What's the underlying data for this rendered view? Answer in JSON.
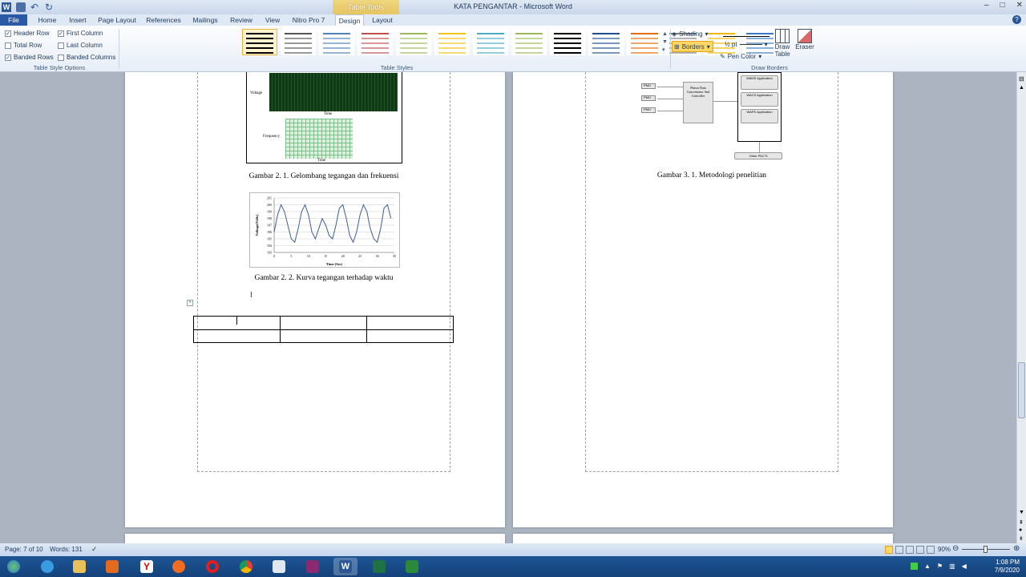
{
  "window": {
    "title": "KATA PENGANTAR - Microsoft Word",
    "context_tab": "Table Tools",
    "controls": [
      "–",
      "□",
      "✕"
    ]
  },
  "tabs": [
    "File",
    "Home",
    "Insert",
    "Page Layout",
    "References",
    "Mailings",
    "Review",
    "View",
    "Nitro Pro 7",
    "Design",
    "Layout"
  ],
  "active_tab": "Design",
  "ribbon": {
    "style_options": {
      "label": "Table Style Options",
      "items": [
        {
          "label": "Header Row",
          "checked": true
        },
        {
          "label": "First Column",
          "checked": true
        },
        {
          "label": "Total Row",
          "checked": false
        },
        {
          "label": "Last Column",
          "checked": false
        },
        {
          "label": "Banded Rows",
          "checked": true
        },
        {
          "label": "Banded Columns",
          "checked": false
        }
      ]
    },
    "table_styles": {
      "label": "Table Styles",
      "colors": [
        "#000000",
        "#555555",
        "#4f81bd",
        "#c0504d",
        "#9bbb59",
        "#f2c314",
        "#4bacc6",
        "#9bbb59",
        "#000000",
        "#1f4e99",
        "#e36c09",
        "#7f7f7f",
        "#f2b800",
        "#3b79c9"
      ]
    },
    "shading_label": "Shading",
    "borders_label": "Borders",
    "pen_weight": "½ pt",
    "pen_color_label": "Pen Color",
    "draw_borders": {
      "label": "Draw Borders",
      "draw_table": "Draw Table",
      "eraser": "Eraser"
    }
  },
  "document": {
    "left_page": {
      "figure1": {
        "caption": "Gambar 2. 1. Gelombang tegangan dan frekuensi",
        "label_voltage": "Voltage",
        "label_frequency": "Frequency",
        "label_time": "Time"
      },
      "figure2": {
        "caption": "Gambar 2. 2. Kurva tegangan terhadap waktu",
        "ylabel": "Voltage(Volts)",
        "xlabel": "Time (Sec)"
      }
    },
    "right_page": {
      "figure3": {
        "caption": "Gambar 3. 1. Metodologi penelitian",
        "pmu": "PMU",
        "pdc": "Phasor Data Concentrator And Controller",
        "apps": [
          "WAMS Application",
          "WACS Application",
          "WAPS Application"
        ],
        "other": "Other PDC'S"
      }
    }
  },
  "chart_data": {
    "type": "line",
    "title": "",
    "xlabel": "Time (Sec)",
    "ylabel": "Voltage(Volts)",
    "xlim": [
      0,
      35
    ],
    "ylim": [
      193,
      201
    ],
    "x_ticks": [
      0,
      5,
      10,
      15,
      20,
      25,
      30,
      35
    ],
    "y_ticks": [
      193,
      194,
      195,
      196,
      197,
      198,
      199,
      200,
      201
    ],
    "series": [
      {
        "x": [
          0,
          1,
          2,
          3,
          4,
          5,
          6,
          7,
          8,
          9,
          10,
          11,
          12,
          13,
          14,
          15,
          16,
          17,
          18,
          19,
          20,
          21,
          22,
          23,
          24,
          25,
          26,
          27,
          28,
          29,
          30,
          31,
          32,
          33,
          34
        ],
        "values": [
          196,
          198.5,
          200,
          199,
          197,
          195,
          194.5,
          196.5,
          199,
          200,
          198.5,
          196,
          195,
          196.5,
          198,
          197,
          195.5,
          195,
          197,
          199.5,
          200,
          198,
          195.5,
          194.5,
          196,
          198.5,
          200,
          199,
          196.5,
          195,
          194.5,
          196.5,
          199.5,
          200,
          198
        ]
      }
    ]
  },
  "status": {
    "page": "Page: 7 of 10",
    "words": "Words: 131",
    "zoom": "90%"
  },
  "tray": {
    "time": "1:08 PM",
    "date": "7/9/2020"
  }
}
